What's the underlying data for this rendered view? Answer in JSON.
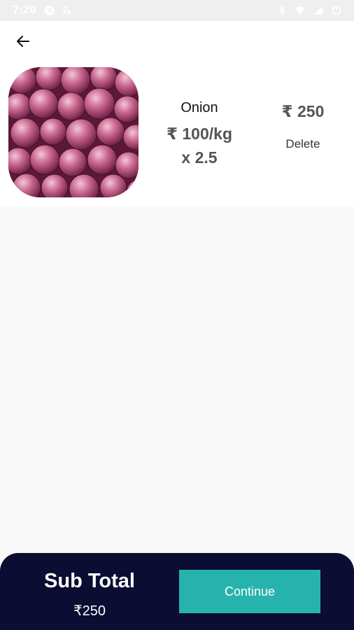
{
  "status_bar": {
    "time": "7:20"
  },
  "header": {
    "back_icon": "arrow-left-icon"
  },
  "cart_item": {
    "name": "Onion",
    "rate": "₹ 100/kg",
    "quantity": "x 2.5",
    "total": "₹ 250",
    "delete_label": "Delete",
    "image_alt": "onions"
  },
  "footer": {
    "subtotal_label": "Sub Total",
    "subtotal_value": "₹250",
    "continue_label": "Continue",
    "bar_color": "#0c0d33",
    "button_color": "#27b3ad"
  }
}
